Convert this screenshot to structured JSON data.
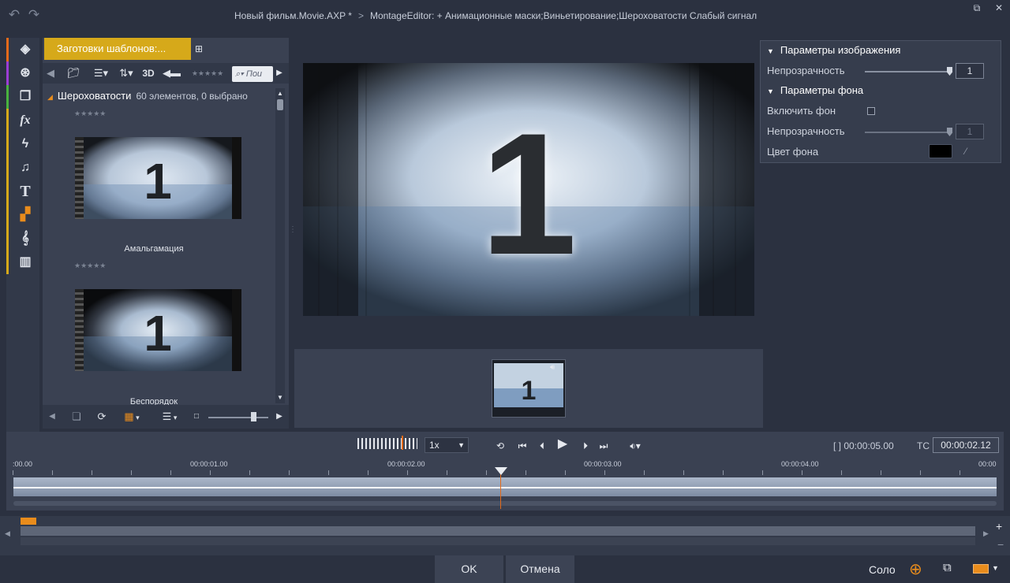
{
  "title_bar": {
    "project": "Новый фильм.Movie.AXP *",
    "separator": ">",
    "editor": "MontageEditor: + Анимационные маски;Виньетирование;Шероховатости  Слабый сигнал",
    "back_icon": "undo-arrow-icon",
    "forward_icon": "redo-arrow-icon"
  },
  "icon_bar": [
    {
      "name": "media-library-icon",
      "stripe": "#e36a1a"
    },
    {
      "name": "reel-icon",
      "stripe": "#9c3dd6"
    },
    {
      "name": "pages-icon",
      "stripe": "#48b23e"
    },
    {
      "name": "fx-icon",
      "stripe": "#d6a91a"
    },
    {
      "name": "lightning-icon",
      "stripe": "#d6a91a"
    },
    {
      "name": "music-icon",
      "stripe": "#d6a91a"
    },
    {
      "name": "title-icon",
      "stripe": "#d6a91a"
    },
    {
      "name": "montage-icon",
      "stripe": "#d6a91a"
    },
    {
      "name": "treble-clef-icon",
      "stripe": "#d6a91a"
    },
    {
      "name": "piano-icon",
      "stripe": "#d6a91a"
    }
  ],
  "library": {
    "tab_label": "Заготовки шаблонов:...",
    "toolbar": {
      "three_d": "3D",
      "search_placeholder": "Пои"
    },
    "collection_name": "Шероховатости",
    "collection_count": "60 элементов, 0 выбрано",
    "stars": "★★★★★",
    "items": [
      {
        "label": "Амальгамация",
        "digit": "1"
      },
      {
        "label": "Беспорядок",
        "digit": "1"
      }
    ]
  },
  "preview": {
    "digit": "1"
  },
  "preview_strip": {
    "digit": "1"
  },
  "params": {
    "image_section": "Параметры изображения",
    "opacity_label": "Непрозрачность",
    "opacity_value": "1",
    "background_section": "Параметры фона",
    "enable_bg_label": "Включить фон",
    "bg_opacity_label": "Непрозрачность",
    "bg_opacity_value": "1",
    "bg_color_label": "Цвет фона",
    "bg_color": "#000000",
    "opacity_level": 1.0,
    "bg_opacity_level": 1.0
  },
  "transport": {
    "speed": "1x",
    "duration": "[ ] 00:00:05.00",
    "tc_label": "TC",
    "timecode": "00:00:02.12"
  },
  "ruler": [
    ":00.00",
    "00:00:01.00",
    "00:00:02.00",
    "00:00:03.00",
    "00:00:04.00",
    "00:00"
  ],
  "footer": {
    "ok": "OK",
    "cancel": "Отмена",
    "solo": "Соло"
  },
  "colors": {
    "accent_tab": "#d6a91a",
    "playhead": "#e36a1a",
    "overview_marker": "#e98c1c"
  }
}
